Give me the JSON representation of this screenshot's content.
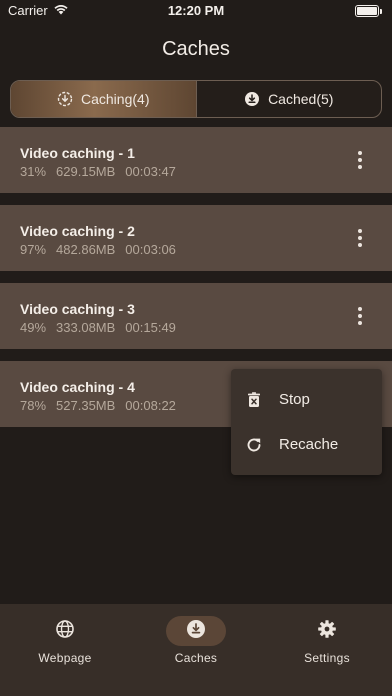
{
  "status_bar": {
    "carrier": "Carrier",
    "time": "12:20 PM"
  },
  "header": {
    "title": "Caches"
  },
  "tabs": [
    {
      "label": "Caching(4)",
      "icon": "caching-icon",
      "active": true
    },
    {
      "label": "Cached(5)",
      "icon": "cached-icon",
      "active": false
    }
  ],
  "items": [
    {
      "title": "Video caching - 1",
      "percent": "31%",
      "size": "629.15MB",
      "duration": "00:03:47"
    },
    {
      "title": "Video caching - 2",
      "percent": "97%",
      "size": "482.86MB",
      "duration": "00:03:06"
    },
    {
      "title": "Video caching - 3",
      "percent": "49%",
      "size": "333.08MB",
      "duration": "00:15:49"
    },
    {
      "title": "Video caching - 4",
      "percent": "78%",
      "size": "527.35MB",
      "duration": "00:08:22"
    }
  ],
  "context_menu": {
    "items": [
      {
        "label": "Stop",
        "icon": "trash-icon"
      },
      {
        "label": "Recache",
        "icon": "refresh-icon"
      }
    ]
  },
  "bottom_nav": [
    {
      "label": "Webpage",
      "icon": "globe-icon",
      "active": false
    },
    {
      "label": "Caches",
      "icon": "download-icon",
      "active": true
    },
    {
      "label": "Settings",
      "icon": "gear-icon",
      "active": false
    }
  ],
  "colors": {
    "background": "#211c19",
    "item_background": "#594a41",
    "accent": "#8a6a4d",
    "tab_bar": "#372e28",
    "menu": "#3b322c"
  }
}
